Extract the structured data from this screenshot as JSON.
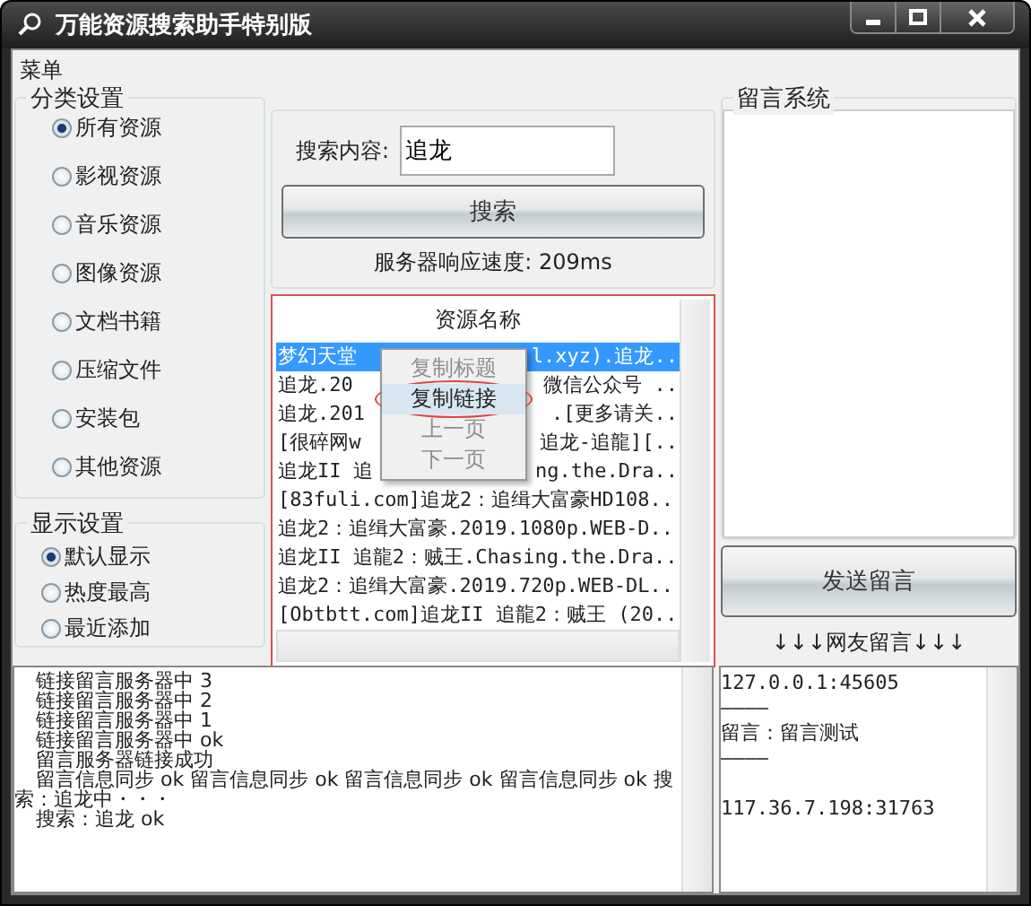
{
  "window": {
    "title": "万能资源搜索助手特别版"
  },
  "menu_bar": [
    "菜单"
  ],
  "category_group": {
    "title": "分类设置",
    "options": [
      {
        "label": "所有资源",
        "selected": true
      },
      {
        "label": "影视资源",
        "selected": false
      },
      {
        "label": "音乐资源",
        "selected": false
      },
      {
        "label": "图像资源",
        "selected": false
      },
      {
        "label": "文档书籍",
        "selected": false
      },
      {
        "label": "压缩文件",
        "selected": false
      },
      {
        "label": "安装包",
        "selected": false
      },
      {
        "label": "其他资源",
        "selected": false
      }
    ]
  },
  "display_group": {
    "title": "显示设置",
    "options": [
      {
        "label": "默认显示",
        "selected": true
      },
      {
        "label": "热度最高",
        "selected": false
      },
      {
        "label": "最近添加",
        "selected": false
      }
    ]
  },
  "search": {
    "label": "搜索内容:",
    "value": "追龙",
    "button": "搜索",
    "speed": "服务器响应速度: 209ms"
  },
  "results": {
    "column": "资源名称",
    "rows": [
      {
        "start": "梦幻天堂",
        "end": "l.xyz).追龙..",
        "selected": true
      },
      {
        "start": "追龙.20",
        "end": "微信公众号 ..",
        "selected": false
      },
      {
        "start": "追龙.201",
        "end": ".[更多请关..",
        "selected": false
      },
      {
        "start": "[很碎网w",
        "end": "追龙-追龍][..",
        "selected": false
      },
      {
        "start": "追龙II 追",
        "end": "ng.the.Dra..",
        "selected": false
      },
      {
        "start": "[83fuli.com]追龙2：追缉大富豪HD108..",
        "selected": false
      },
      {
        "start": "追龙2：追缉大富豪.2019.1080p.WEB-D..",
        "selected": false
      },
      {
        "start": "追龙II 追龍2：贼王.Chasing.the.Dra..",
        "selected": false
      },
      {
        "start": "追龙2：追缉大富豪.2019.720p.WEB-DL..",
        "selected": false
      },
      {
        "start": "[Obtbtt.com]追龙II 追龍2：贼王 (20..",
        "selected": false
      }
    ]
  },
  "context_menu": [
    {
      "label": "复制标题",
      "disabled": true,
      "selected": false
    },
    {
      "label": "复制链接",
      "disabled": false,
      "selected": true
    },
    {
      "label": "上一页",
      "disabled": true,
      "selected": false
    },
    {
      "label": "下一页",
      "disabled": true,
      "selected": false
    }
  ],
  "message_group": {
    "title": "留言系统",
    "send_button": "发送留言",
    "feed_title": "↓↓↓网友留言↓↓↓"
  },
  "status_log": [
    "链接留言服务器中  3",
    "链接留言服务器中  2",
    "链接留言服务器中  1",
    "链接留言服务器中  ok",
    "留言服务器链接成功",
    "留言信息同步  ok  留言信息同步  ok  留言信息同步  ok  留言信息同步  ok  搜索：追龙中・・・",
    "搜索：追龙  ok"
  ],
  "message_log": [
    "127.0.0.1:45605",
    "————",
    "留言：留言测试",
    "————",
    "117.36.7.198:31763"
  ]
}
